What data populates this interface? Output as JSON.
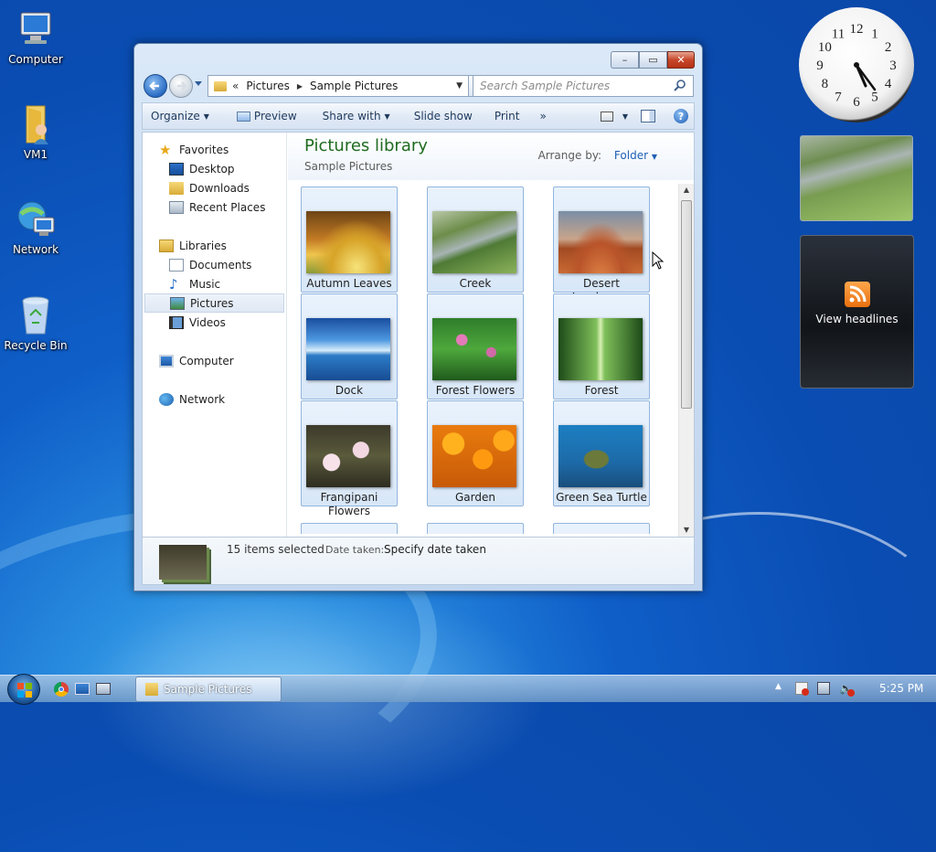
{
  "desktop": {
    "icons": [
      {
        "label": "Computer",
        "icon": "computer-icon"
      },
      {
        "label": "VM1",
        "icon": "user-folder-icon"
      },
      {
        "label": "Network",
        "icon": "network-icon"
      },
      {
        "label": "Recycle Bin",
        "icon": "recycle-bin-icon"
      }
    ]
  },
  "window": {
    "title_buttons": {
      "minimize": "–",
      "maximize": "▭",
      "close": "✕"
    },
    "address": {
      "prefix": "«",
      "crumbs": [
        "Pictures",
        "Sample Pictures"
      ]
    },
    "search": {
      "placeholder": "Search Sample Pictures"
    },
    "toolbar": {
      "organize": "Organize",
      "preview": "Preview",
      "share_with": "Share with",
      "slide_show": "Slide show",
      "print": "Print",
      "more": "»"
    },
    "nav": {
      "favorites": "Favorites",
      "desktop": "Desktop",
      "downloads": "Downloads",
      "recent_places": "Recent Places",
      "libraries": "Libraries",
      "documents": "Documents",
      "music": "Music",
      "pictures": "Pictures",
      "videos": "Videos",
      "computer": "Computer",
      "network": "Network"
    },
    "library": {
      "title": "Pictures library",
      "subtitle": "Sample Pictures",
      "arrange_label": "Arrange by:",
      "arrange_value": "Folder"
    },
    "files": [
      {
        "name": "Autumn Leaves"
      },
      {
        "name": "Creek"
      },
      {
        "name": "Desert Landscape"
      },
      {
        "name": "Dock"
      },
      {
        "name": "Forest Flowers"
      },
      {
        "name": "Forest"
      },
      {
        "name": "Frangipani Flowers"
      },
      {
        "name": "Garden"
      },
      {
        "name": "Green Sea Turtle"
      }
    ],
    "details": {
      "selected": "15 items selected",
      "date_label": "Date taken:",
      "date_value": "Specify date taken"
    }
  },
  "gadgets": {
    "clock": {
      "time": "5:25",
      "numerals": [
        "12",
        "1",
        "2",
        "3",
        "4",
        "5",
        "6",
        "7",
        "8",
        "9",
        "10",
        "11"
      ]
    },
    "feed": {
      "label": "View headlines"
    }
  },
  "taskbar": {
    "active_window": "Sample Pictures",
    "time": "5:25 PM"
  }
}
